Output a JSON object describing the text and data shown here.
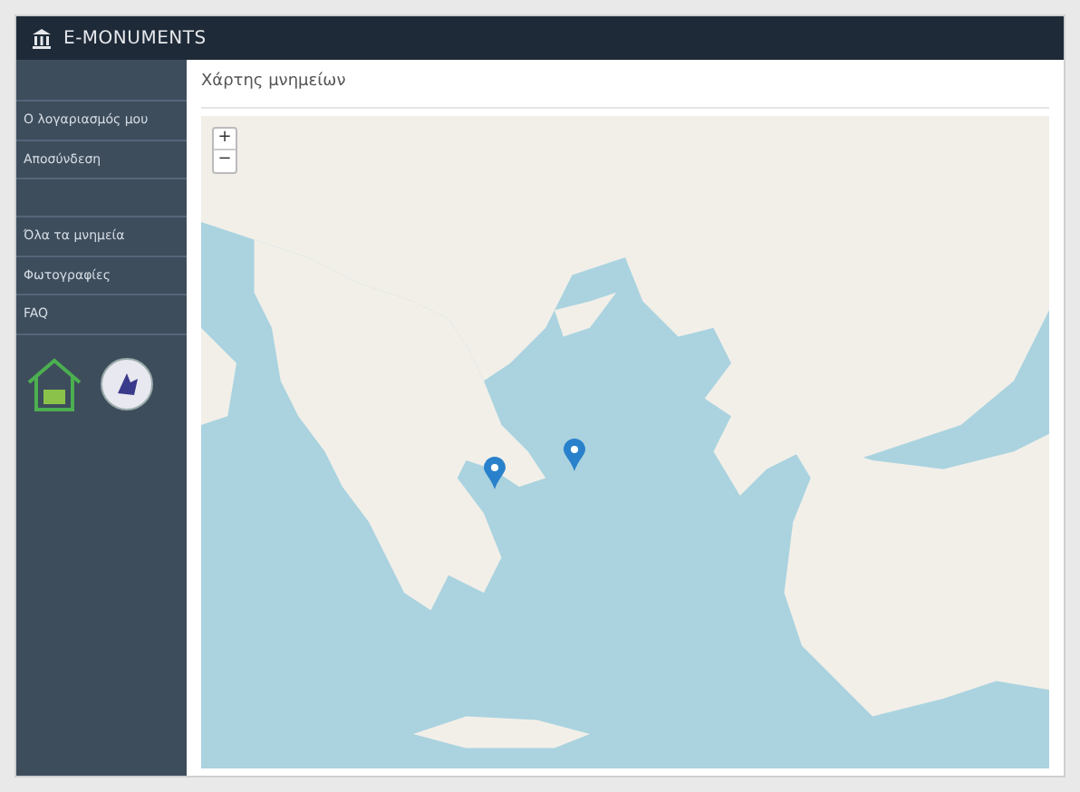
{
  "header": {
    "title": "E-MONUMENTS"
  },
  "sidebar": {
    "groups": [
      [
        {
          "label": "Ο λογαριασμός μου"
        },
        {
          "label": "Αποσύνδεση"
        }
      ],
      [
        {
          "label": "Όλα τα μνημεία"
        },
        {
          "label": "Φωτογραφίες"
        },
        {
          "label": "FAQ"
        }
      ]
    ]
  },
  "page": {
    "title": "Χάρτης μνημείων"
  },
  "map": {
    "zoom_in": "+",
    "zoom_out": "−"
  }
}
